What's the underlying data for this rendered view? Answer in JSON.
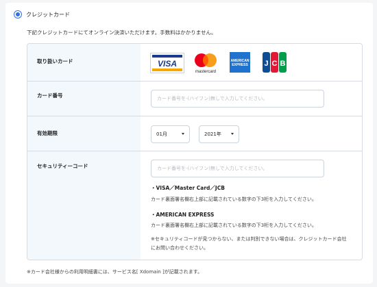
{
  "payment_option": {
    "label": "クレジットカード",
    "selected": true,
    "accent_color": "#2f6fe0"
  },
  "intro_text": "下記クレジットカードにてオンライン決済いただけます。手数料はかかりません。",
  "rows": {
    "accepted_cards": {
      "label": "取り扱いカード",
      "cards": [
        {
          "name": "VISA",
          "icon": "visa-logo"
        },
        {
          "name": "mastercard",
          "icon": "mastercard-logo"
        },
        {
          "name": "AMERICAN EXPRESS",
          "icon": "amex-logo"
        },
        {
          "name": "JCB",
          "icon": "jcb-logo"
        }
      ]
    },
    "card_number": {
      "label": "カード番号",
      "placeholder": "カード番号を-(ハイフン)無しで入力してください。",
      "value": ""
    },
    "expiry": {
      "label": "有効期限",
      "month": "01月",
      "year": "2021年"
    },
    "security_code": {
      "label": "セキュリティーコード",
      "placeholder": "カード番号を-(ハイフン)無しで入力してください。",
      "value": "",
      "note_visa_mc_jcb_title": "・VISA／Master Card／JCB",
      "note_visa_mc_jcb_text": "カード裏面署名欄右上部に記載されている数字の下3桁を入力してください。",
      "note_amex_title": "・AMERICAN EXPRESS",
      "note_amex_text": "カード裏面署名欄右上部に記載されている数字の下3桁を入力してください。",
      "note_unknown": "※セキュリティコードが見つからない、または判別できない場合は、クレジットカード会社にお問い合わせください。"
    }
  },
  "footer_note": "※カード会社様からの利用明細書には、サービス名[ Xdomain ]が記載されます。"
}
